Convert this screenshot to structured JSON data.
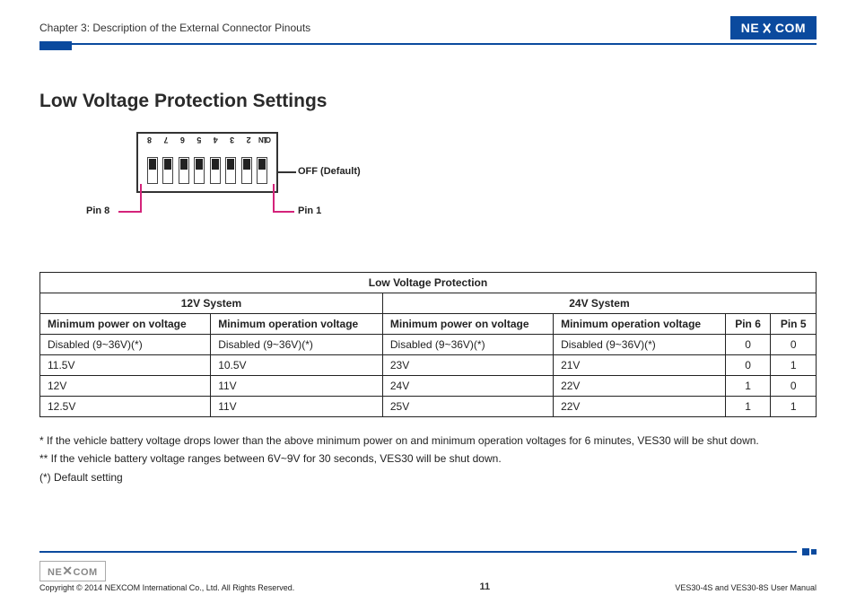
{
  "header": {
    "chapter": "Chapter 3: Description of the External Connector Pinouts",
    "brand": "NEXCOM"
  },
  "section": {
    "title": "Low Voltage Protection Settings"
  },
  "dip": {
    "numbers": [
      "1",
      "2",
      "3",
      "4",
      "5",
      "6",
      "7",
      "8"
    ],
    "on": "ON",
    "off_label": "OFF (Default)",
    "pin1": "Pin 1",
    "pin8": "Pin 8"
  },
  "table": {
    "caption": "Low Voltage Protection",
    "group12": "12V System",
    "group24": "24V System",
    "cols": {
      "min_power": "Minimum power on voltage",
      "min_op": "Minimum operation voltage",
      "pin6": "Pin 6",
      "pin5": "Pin 5"
    },
    "rows": [
      {
        "p12": "Disabled (9~36V)(*)",
        "o12": "Disabled (9~36V)(*)",
        "p24": "Disabled (9~36V)(*)",
        "o24": "Disabled (9~36V)(*)",
        "pin6": "0",
        "pin5": "0"
      },
      {
        "p12": "11.5V",
        "o12": "10.5V",
        "p24": "23V",
        "o24": "21V",
        "pin6": "0",
        "pin5": "1"
      },
      {
        "p12": "12V",
        "o12": "11V",
        "p24": "24V",
        "o24": "22V",
        "pin6": "1",
        "pin5": "0"
      },
      {
        "p12": "12.5V",
        "o12": "11V",
        "p24": "25V",
        "o24": "22V",
        "pin6": "1",
        "pin5": "1"
      }
    ]
  },
  "notes": {
    "n1": "* If the vehicle battery voltage drops lower than the above minimum power on and minimum operation voltages for 6 minutes, VES30 will be shut down.",
    "n2": "** If the vehicle battery voltage ranges between 6V~9V for 30 seconds, VES30 will be shut down.",
    "n3": "(*) Default setting"
  },
  "footer": {
    "copyright": "Copyright © 2014 NEXCOM International Co., Ltd. All Rights Reserved.",
    "page": "11",
    "manual": "VES30-4S and VES30-8S User Manual",
    "brand": "NEXCOM"
  }
}
